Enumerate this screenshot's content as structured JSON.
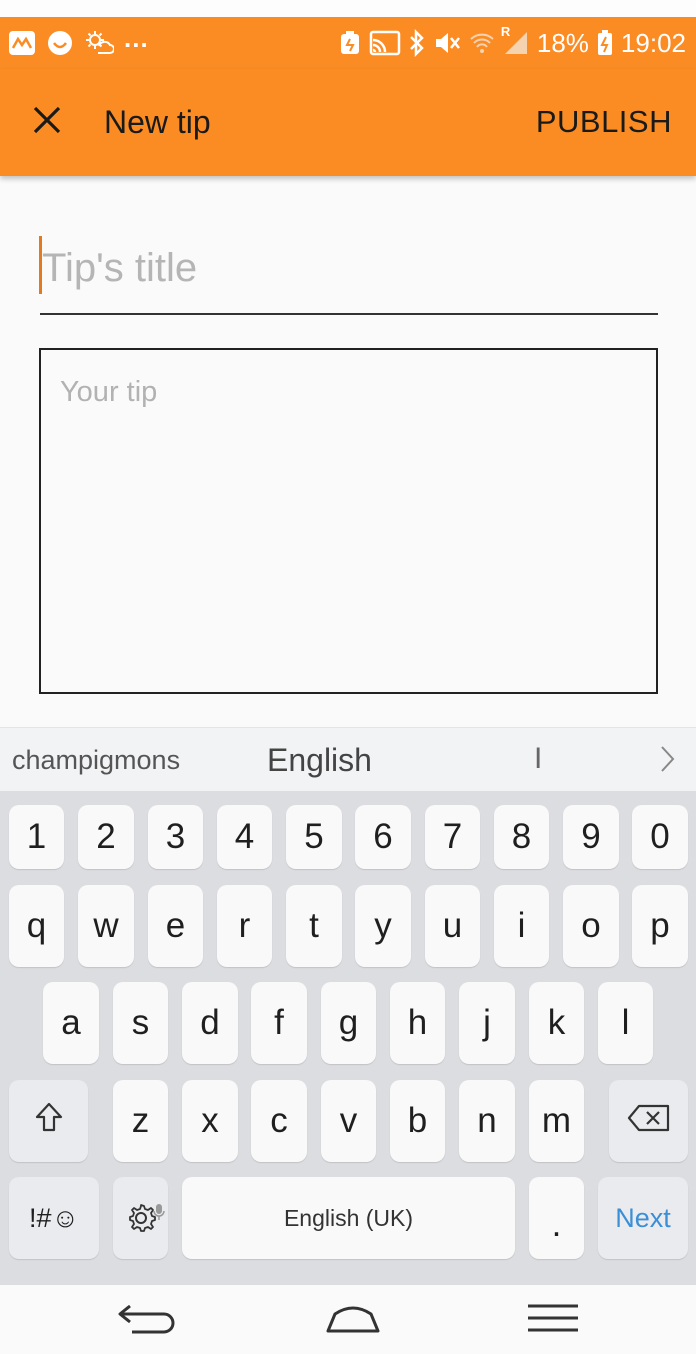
{
  "status_bar": {
    "left_icons": [
      "app-notification-icon",
      "chat-bubble-icon",
      "weather-icon"
    ],
    "more_indicator": "...",
    "right_icons": [
      "battery-saver-icon",
      "cast-icon",
      "bluetooth-icon",
      "mute-icon",
      "wifi-icon",
      "signal-icon"
    ],
    "roaming": "R",
    "battery": "18%",
    "time": "19:02"
  },
  "app_bar": {
    "title": "New tip",
    "publish_label": "PUBLISH",
    "background": "#fb8c24"
  },
  "form": {
    "title_placeholder": "Tip's title",
    "title_value": "",
    "tip_placeholder": "Your tip",
    "tip_value": ""
  },
  "suggestions": {
    "items": [
      "champigmons",
      "English",
      "I"
    ]
  },
  "keyboard": {
    "number_row": [
      "1",
      "2",
      "3",
      "4",
      "5",
      "6",
      "7",
      "8",
      "9",
      "0"
    ],
    "row_1": [
      "q",
      "w",
      "e",
      "r",
      "t",
      "y",
      "u",
      "i",
      "o",
      "p"
    ],
    "row_2": [
      "a",
      "s",
      "d",
      "f",
      "g",
      "h",
      "j",
      "k",
      "l"
    ],
    "row_3": [
      "z",
      "x",
      "c",
      "v",
      "b",
      "n",
      "m"
    ],
    "symbols_label": "!#☺",
    "space_label": "English (UK)",
    "period_label": ".",
    "action_label": "Next"
  },
  "colors": {
    "accent": "#fb8c24",
    "cursor": "#e07b22",
    "action_key_text": "#3b8fd6"
  }
}
